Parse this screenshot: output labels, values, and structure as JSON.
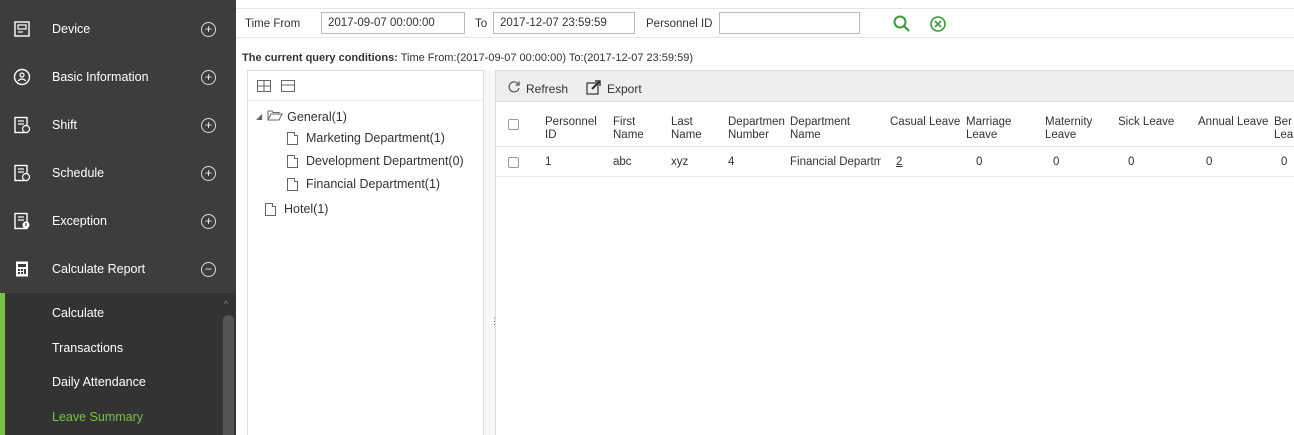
{
  "sidebar": {
    "items": [
      {
        "label": "Device",
        "icon": "device-icon",
        "toggle": "+"
      },
      {
        "label": "Basic Information",
        "icon": "basic-information-icon",
        "toggle": "+"
      },
      {
        "label": "Shift",
        "icon": "shift-icon",
        "toggle": "+"
      },
      {
        "label": "Schedule",
        "icon": "schedule-icon",
        "toggle": "+"
      },
      {
        "label": "Exception",
        "icon": "exception-icon",
        "toggle": "+"
      },
      {
        "label": "Calculate Report",
        "icon": "calculate-report-icon",
        "toggle": "−"
      }
    ],
    "sub_items": [
      {
        "label": "Calculate"
      },
      {
        "label": "Transactions"
      },
      {
        "label": "Daily Attendance"
      },
      {
        "label": "Leave Summary",
        "active": true
      }
    ]
  },
  "filter": {
    "time_from_label": "Time From",
    "time_from_value": "2017-09-07 00:00:00",
    "to_label": "To",
    "to_value": "2017-12-07 23:59:59",
    "personnel_label": "Personnel ID",
    "personnel_value": ""
  },
  "query": {
    "label": "The current query conditions:",
    "text": "Time From:(2017-09-07 00:00:00)  To:(2017-12-07 23:59:59)"
  },
  "tree": {
    "general": "General(1)",
    "children": [
      "Marketing Department(1)",
      "Development Department(0)",
      "Financial Department(1)"
    ],
    "hotel": "Hotel(1)"
  },
  "toolbar": {
    "refresh": "Refresh",
    "export": "Export"
  },
  "grid": {
    "headers": {
      "personnel_id": [
        "Personnel",
        "ID"
      ],
      "first_name": [
        "First",
        "Name"
      ],
      "last_name": [
        "Last",
        "Name"
      ],
      "dept_number": [
        "Departmen",
        "Number"
      ],
      "dept_name": [
        "Department",
        "Name"
      ],
      "casual": [
        "Casual Leave",
        ""
      ],
      "marriage": [
        "Marriage",
        "Leave"
      ],
      "maternity": [
        "Maternity",
        "Leave"
      ],
      "sick": [
        "Sick Leave",
        ""
      ],
      "annual": [
        "Annual Leave",
        ""
      ],
      "bereavement": [
        "Ber",
        "Lea"
      ]
    },
    "rows": [
      {
        "personnel_id": "1",
        "first_name": "abc",
        "last_name": "xyz",
        "dept_number": "4",
        "dept_name": "Financial Departm",
        "casual": "2",
        "marriage": "0",
        "maternity": "0",
        "sick": "0",
        "annual": "0",
        "bereavement": "0"
      }
    ]
  },
  "colors": {
    "sidebar_bg": "#3d3d3d",
    "accent_green": "#7ac143",
    "search_icon": "#3a9a3a"
  }
}
